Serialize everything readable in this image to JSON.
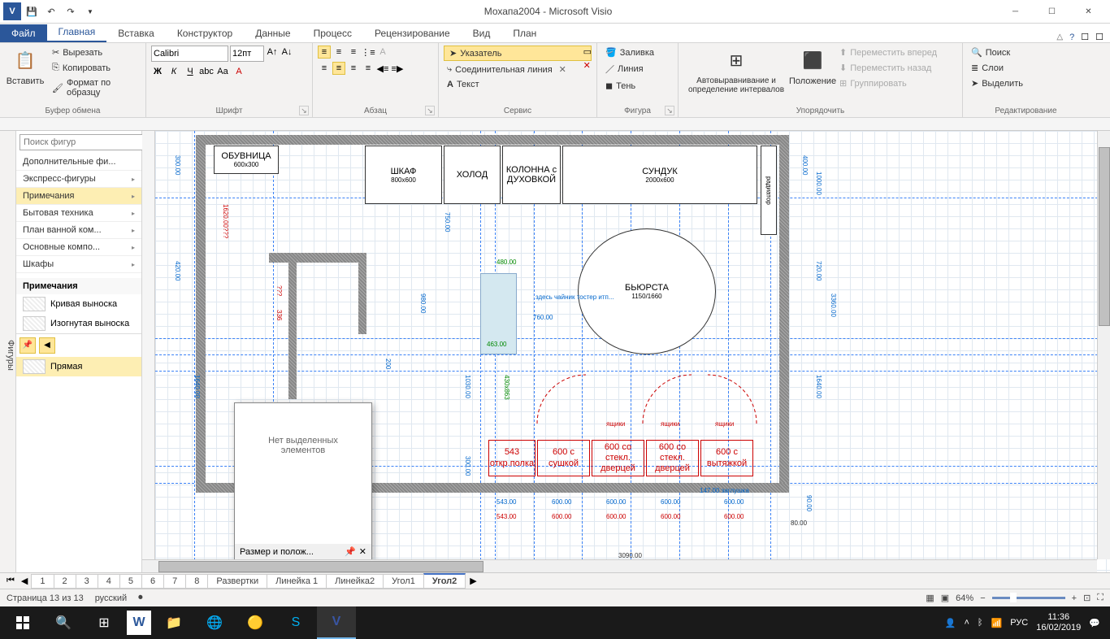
{
  "app": {
    "title": "Мохапа2004  -  Microsoft Visio"
  },
  "qat": [
    "V",
    "save",
    "undo",
    "redo",
    "down"
  ],
  "file_tab": "Файл",
  "ribbon_tabs": [
    "Главная",
    "Вставка",
    "Конструктор",
    "Данные",
    "Процесс",
    "Рецензирование",
    "Вид",
    "План"
  ],
  "active_tab": 0,
  "ribbon_groups": {
    "clipboard": {
      "label": "Буфер обмена",
      "paste": "Вставить",
      "cut": "Вырезать",
      "copy": "Копировать",
      "format": "Формат по образцу"
    },
    "font": {
      "label": "Шрифт",
      "name": "Calibri",
      "size": "12пт"
    },
    "paragraph": {
      "label": "Абзац"
    },
    "tools": {
      "label": "Сервис",
      "pointer": "Указатель",
      "connector": "Соединительная линия",
      "text": "Текст"
    },
    "shape": {
      "label": "Фигура",
      "fill": "Заливка",
      "line": "Линия",
      "shadow": "Тень"
    },
    "arrange": {
      "label": "Упорядочить",
      "autoalign": "Автовыравнивание и определение интервалов",
      "position": "Положение",
      "forward": "Переместить вперед",
      "backward": "Переместить назад",
      "group": "Группировать"
    },
    "editing": {
      "label": "Редактирование",
      "find": "Поиск",
      "layers": "Слои",
      "select": "Выделить"
    }
  },
  "shapes_panel": {
    "tab_label": "Фигуры",
    "search_placeholder": "Поиск фигур",
    "categories": [
      "Дополнительные фи...",
      "Экспресс-фигуры",
      "Примечания",
      "Бытовая техника",
      "План ванной ком...",
      "Основные компо...",
      "Шкафы"
    ],
    "selected_cat": 2,
    "section": "Примечания",
    "items": [
      {
        "label": "Кривая выноска"
      },
      {
        "label": "Изогнутая выноска"
      },
      {
        "label": "Прямая"
      }
    ],
    "active_item": 2
  },
  "canvas": {
    "furniture": {
      "shoe": "ОБУВНИЦА",
      "shoe_dim": "600х300",
      "wardrobe": "ШКАФ",
      "wardrobe_dim": "800х600",
      "fridge": "ХОЛОД",
      "column": "КОЛОННА с",
      "column2": "ДУХОВКОЙ",
      "chest": "СУНДУК",
      "chest_dim": "2000х600",
      "table": "БЬЮРСТА",
      "table_dim": "1150/1660",
      "radiator": "радиатор"
    },
    "note": "здесь чайник тостер итп...",
    "drawer_labels": [
      "ящики",
      "ящики",
      "ящики"
    ],
    "redboxes": [
      {
        "l1": "543",
        "l2": "откр.полка"
      },
      {
        "l1": "600 c сушкой"
      },
      {
        "l1": "600 со стекл.",
        "l2": "дверцей"
      },
      {
        "l1": "600 со стекл.",
        "l2": "дверцей"
      },
      {
        "l1": "600 с",
        "l2": "вытяжкой"
      }
    ],
    "dims_blue": [
      "543.00",
      "600.00",
      "600.00",
      "600.00",
      "600.00",
      "147.00 заглушка",
      "400.00",
      "1000.00",
      "720.00",
      "90.00",
      "80.00",
      "750.00",
      "980.00",
      "1030.00",
      "300.00",
      "760.00",
      "463.00",
      "430х863",
      "300.00",
      "200",
      "1640.00",
      "420.00",
      "1640.00",
      "3360.00",
      "480.00"
    ],
    "dims_red": [
      "543.00",
      "600.00",
      "600.00",
      "600.00",
      "600.00",
      "1620.00???",
      "336",
      "???"
    ],
    "bottom_dim": "3090.00"
  },
  "floatwin": {
    "title": "Размер и полож...",
    "body": "Нет выделенных элементов"
  },
  "page_tabs": [
    "Развертки",
    "Линейка 1",
    "Линейка2",
    "Угол1",
    "Угол2"
  ],
  "page_tabs_extra": [
    "1",
    "2",
    "3",
    "4",
    "5",
    "6",
    "7",
    "8"
  ],
  "active_page": 4,
  "statusbar": {
    "page": "Страница 13 из 13",
    "lang": "русский",
    "zoom": "64%"
  },
  "taskbar": {
    "time": "11:36",
    "date": "16/02/2019",
    "lang": "РУС"
  }
}
